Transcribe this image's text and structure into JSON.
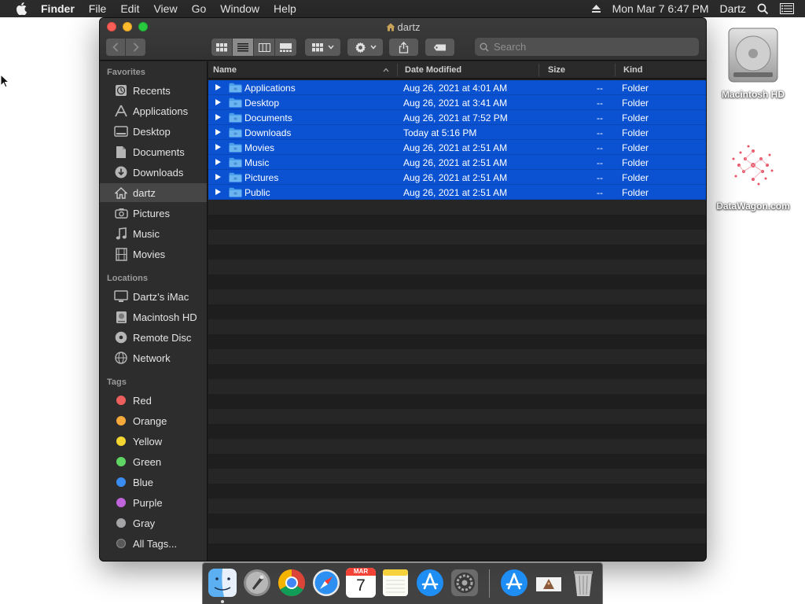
{
  "menubar": {
    "app_name": "Finder",
    "menus": [
      "File",
      "Edit",
      "View",
      "Go",
      "Window",
      "Help"
    ],
    "clock": "Mon Mar 7  6:47 PM",
    "user": "Dartz"
  },
  "desktop": {
    "icons": [
      {
        "label": "Macintosh HD",
        "icon": "hard-drive-icon"
      },
      {
        "label": "DataWagon.com",
        "icon": "image-file-icon"
      }
    ]
  },
  "window": {
    "title": "dartz",
    "search_placeholder": "Search",
    "view_mode": "list",
    "sidebar": {
      "favorites_header": "Favorites",
      "favorites": [
        {
          "label": "Recents",
          "icon": "clock-icon"
        },
        {
          "label": "Applications",
          "icon": "applications-icon"
        },
        {
          "label": "Desktop",
          "icon": "desktop-icon"
        },
        {
          "label": "Documents",
          "icon": "document-icon"
        },
        {
          "label": "Downloads",
          "icon": "download-icon"
        },
        {
          "label": "dartz",
          "icon": "home-icon",
          "selected": true
        },
        {
          "label": "Pictures",
          "icon": "camera-icon"
        },
        {
          "label": "Music",
          "icon": "music-note-icon"
        },
        {
          "label": "Movies",
          "icon": "film-icon"
        }
      ],
      "locations_header": "Locations",
      "locations": [
        {
          "label": "Dartz’s iMac",
          "icon": "imac-icon"
        },
        {
          "label": "Macintosh HD",
          "icon": "hard-drive-icon"
        },
        {
          "label": "Remote Disc",
          "icon": "disc-icon"
        },
        {
          "label": "Network",
          "icon": "globe-icon"
        }
      ],
      "tags_header": "Tags",
      "tags": [
        {
          "label": "Red",
          "color": "#ec5f5d"
        },
        {
          "label": "Orange",
          "color": "#f4a93a"
        },
        {
          "label": "Yellow",
          "color": "#f5d630"
        },
        {
          "label": "Green",
          "color": "#5fd563"
        },
        {
          "label": "Blue",
          "color": "#3b8cf0"
        },
        {
          "label": "Purple",
          "color": "#c064dc"
        },
        {
          "label": "Gray",
          "color": "#a5a5a8"
        },
        {
          "label": "All Tags...",
          "color": "#5a5a5a"
        }
      ]
    },
    "columns": {
      "name": "Name",
      "date": "Date Modified",
      "size": "Size",
      "kind": "Kind"
    },
    "files": [
      {
        "name": "Applications",
        "date": "Aug 26, 2021 at 4:01 AM",
        "size": "--",
        "kind": "Folder"
      },
      {
        "name": "Desktop",
        "date": "Aug 26, 2021 at 3:41 AM",
        "size": "--",
        "kind": "Folder"
      },
      {
        "name": "Documents",
        "date": "Aug 26, 2021 at 7:52 PM",
        "size": "--",
        "kind": "Folder"
      },
      {
        "name": "Downloads",
        "date": "Today at 5:16 PM",
        "size": "--",
        "kind": "Folder"
      },
      {
        "name": "Movies",
        "date": "Aug 26, 2021 at 2:51 AM",
        "size": "--",
        "kind": "Folder"
      },
      {
        "name": "Music",
        "date": "Aug 26, 2021 at 2:51 AM",
        "size": "--",
        "kind": "Folder"
      },
      {
        "name": "Pictures",
        "date": "Aug 26, 2021 at 2:51 AM",
        "size": "--",
        "kind": "Folder"
      },
      {
        "name": "Public",
        "date": "Aug 26, 2021 at 2:51 AM",
        "size": "--",
        "kind": "Folder"
      }
    ]
  },
  "dock": {
    "apps": [
      "finder-icon",
      "launchpad-icon",
      "chrome-icon",
      "safari-icon",
      "calendar-icon",
      "notes-icon",
      "app-store-icon",
      "system-preferences-icon",
      "app-store-downloads-icon",
      "documents-stack-icon",
      "trash-icon"
    ],
    "calendar": {
      "month": "MAR",
      "day": "7"
    }
  },
  "colors": {
    "selection": "#0a52d2",
    "folder": "#4a9fe8",
    "accent": "#0a52d2"
  }
}
